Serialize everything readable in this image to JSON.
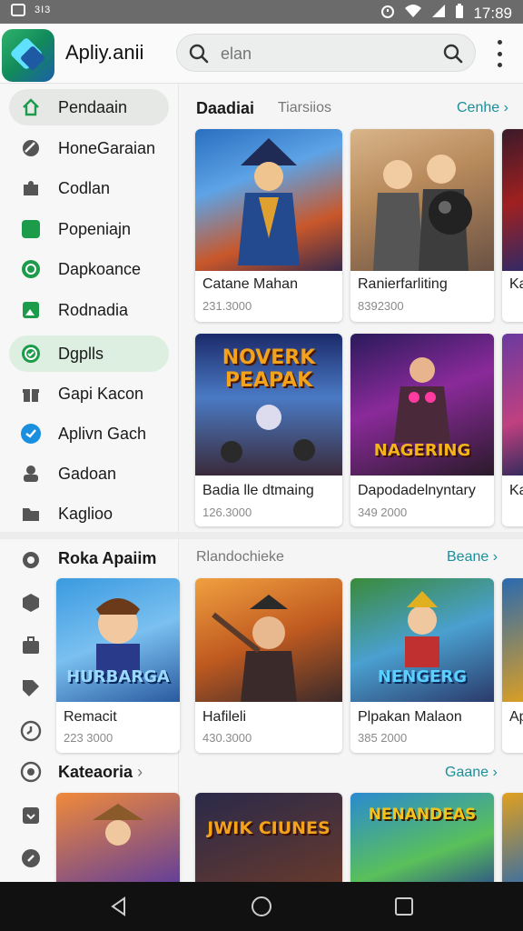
{
  "status_bar": {
    "left_label": "3I3",
    "time": "17:89"
  },
  "app": {
    "title": "Apliy.anii"
  },
  "search": {
    "placeholder": "elan"
  },
  "sidebar": {
    "items": [
      {
        "label": "Pendaain",
        "icon": "home-icon"
      },
      {
        "label": "HoneGaraian",
        "icon": "globe-icon"
      },
      {
        "label": "Codlan",
        "icon": "puzzle-icon"
      },
      {
        "label": "Popeniajn",
        "icon": "green-tile-icon"
      },
      {
        "label": "Dapkoance",
        "icon": "leaf-icon"
      },
      {
        "label": "Rodnadia",
        "icon": "photo-icon"
      },
      {
        "label": "Dgplls",
        "icon": "check-circle-icon"
      },
      {
        "label": "Gapi Kacon",
        "icon": "gift-icon"
      },
      {
        "label": "Aplivn Gach",
        "icon": "bird-icon"
      },
      {
        "label": "Gadoan",
        "icon": "person-icon"
      },
      {
        "label": "Kaglioo",
        "icon": "folder-icon"
      }
    ]
  },
  "section1": {
    "title": "Daadiai",
    "tab": "Tiarsiios",
    "link": "Cenhe",
    "cards": [
      {
        "title": "Catane Mahan",
        "sub": "231.3000"
      },
      {
        "title": "Ranierfarliting",
        "sub": "8392300"
      },
      {
        "title": "Ka",
        "sub": ""
      },
      {
        "title": "Badia lle dtmaing",
        "sub": "126.3000",
        "art_text": "NOVERK PEAPAK"
      },
      {
        "title": "Dapodadelnyntary",
        "sub": "349 2000",
        "art_text": "NAGERING"
      },
      {
        "title": "Ka",
        "sub": ""
      }
    ]
  },
  "section2": {
    "title": "Roka Apaiim",
    "tab": "Rlandochieke",
    "link": "Beane",
    "cards": [
      {
        "title": "Remacit",
        "sub": "223 3000",
        "art_text": "HURBARGA"
      },
      {
        "title": "Hafileli",
        "sub": "430.3000"
      },
      {
        "title": "Plpakan Malaon",
        "sub": "385 2000",
        "art_text": "NENGERG"
      },
      {
        "title": "Ap",
        "sub": ""
      }
    ]
  },
  "section3": {
    "title": "Kateaoria",
    "link": "Gaane",
    "cards": [
      {
        "art_text": ""
      },
      {
        "art_text": "JWIK CIUNES"
      },
      {
        "art_text": "NENANDEAS"
      },
      {
        "art_text": ""
      }
    ]
  },
  "colors": {
    "accent": "#1d8f9a",
    "brand_green": "#1c9c4a",
    "active_nav": "#dcefe0"
  }
}
